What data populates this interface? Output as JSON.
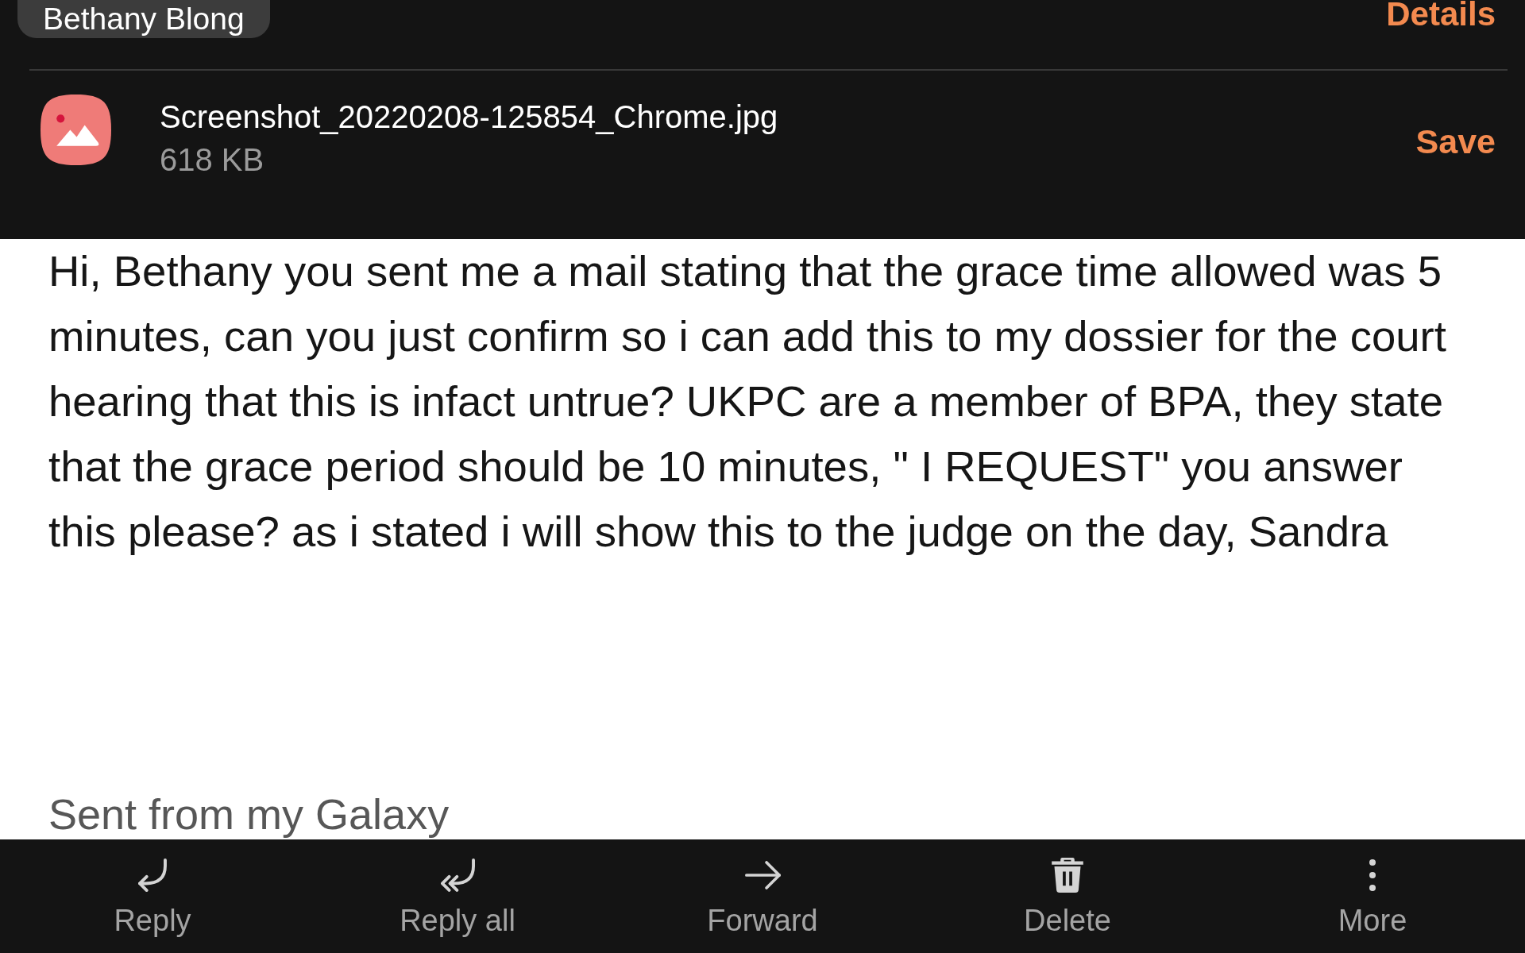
{
  "header": {
    "sender_chip": "Bethany Blong",
    "details_link": "Details"
  },
  "attachment": {
    "file_name": "Screenshot_20220208-125854_Chrome.jpg",
    "file_size": "618 KB",
    "save_button": "Save"
  },
  "body": {
    "message": "Hi, Bethany you sent me a mail stating that the grace time allowed was 5 minutes, can you just confirm so i can add this to my dossier for the court hearing that this is infact untrue? UKPC are a member of BPA, they state that the grace period should be 10 minutes, \" I REQUEST\" you answer this please? as i stated i will show this to the judge on the day, Sandra",
    "signature": "Sent from my Galaxy"
  },
  "bottom_bar": [
    {
      "kind": "reply",
      "label": "Reply"
    },
    {
      "kind": "reply_all",
      "label": "Reply all"
    },
    {
      "kind": "forward",
      "label": "Forward"
    },
    {
      "kind": "delete",
      "label": "Delete"
    },
    {
      "kind": "more",
      "label": "More"
    }
  ]
}
